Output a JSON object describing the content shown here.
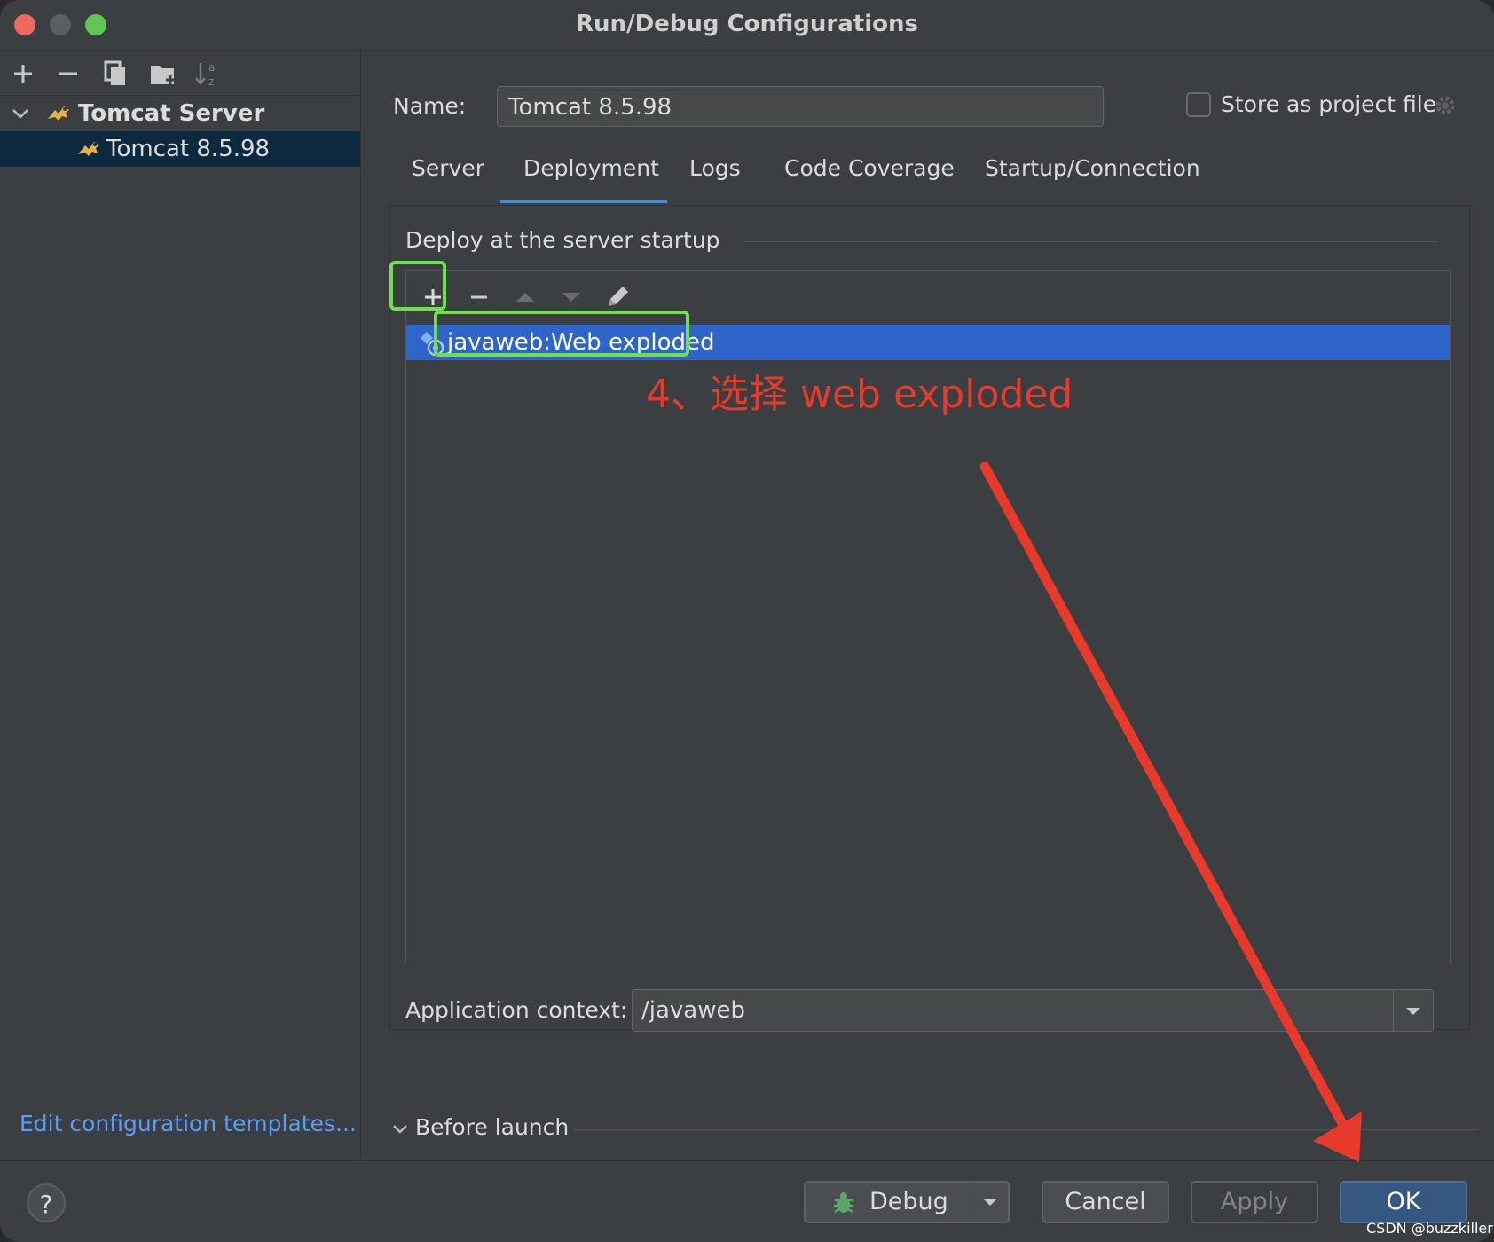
{
  "window": {
    "title": "Run/Debug Configurations"
  },
  "sidebar": {
    "tree": [
      {
        "label": "Tomcat Server",
        "expanded": true
      },
      {
        "label": "Tomcat 8.5.98",
        "selected": true
      }
    ],
    "edit_templates_link": "Edit configuration templates..."
  },
  "form": {
    "name_label": "Name:",
    "name_value": "Tomcat 8.5.98",
    "store_label": "Store as project file",
    "store_checked": false
  },
  "tabs": [
    {
      "label": "Server"
    },
    {
      "label": "Deployment",
      "active": true
    },
    {
      "label": "Logs"
    },
    {
      "label": "Code Coverage"
    },
    {
      "label": "Startup/Connection"
    }
  ],
  "deployment": {
    "group_title": "Deploy at the server startup",
    "artifacts": [
      {
        "label": "javaweb:Web exploded",
        "selected": true
      }
    ],
    "annotation": "4、选择 web exploded",
    "context_label": "Application context:",
    "context_value": "/javaweb"
  },
  "before_launch": {
    "label": "Before launch"
  },
  "buttons": {
    "help": "?",
    "debug": "Debug",
    "cancel": "Cancel",
    "apply": "Apply",
    "ok": "OK"
  },
  "watermark": "CSDN @buzzkiller",
  "colors": {
    "selection": "#2f65ca",
    "highlight_box": "#6fe04a",
    "annotation": "#e8392b",
    "link": "#589df6",
    "primary_button": "#365880"
  }
}
